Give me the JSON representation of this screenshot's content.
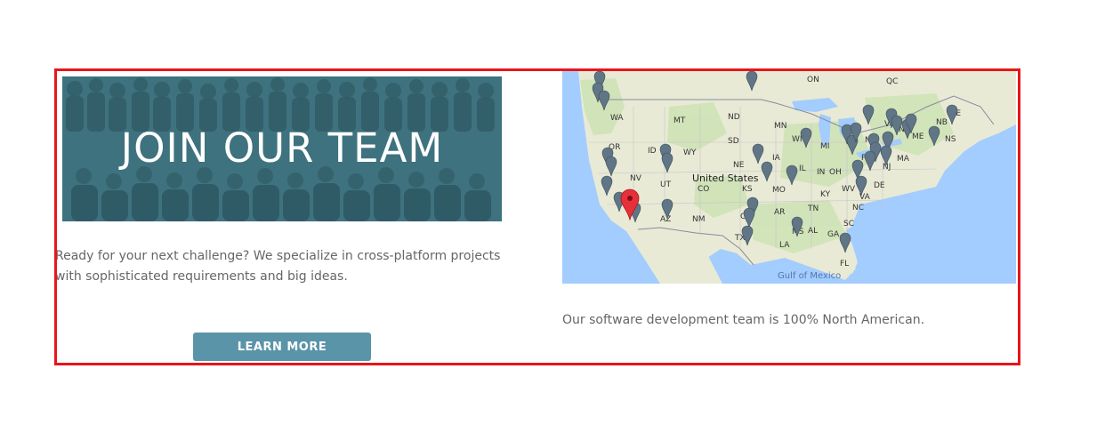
{
  "colors": {
    "frame_border": "#e8151b",
    "button_bg": "#5a94a9",
    "banner_overlay": "#3b6f7c",
    "body_text": "#666666",
    "map_water": "#a3ccff",
    "map_land": "#e8ead5",
    "marker_gray": "#607585",
    "marker_red": "#e8303a"
  },
  "recruiting": {
    "banner_title": "JOIN OUR TEAM",
    "intro_text": "Ready for your next challenge? We specialize in cross-platform projects with sophisticated requirements and big ideas.",
    "button_label": "LEARN MORE"
  },
  "map": {
    "country_label": "United States",
    "water_label": "Gulf of Mexico",
    "region_labels": [
      "ON",
      "QC",
      "NB",
      "PE",
      "NS",
      "WA",
      "MT",
      "ND",
      "MN",
      "OR",
      "ID",
      "WY",
      "SD",
      "WI",
      "MI",
      "NY",
      "VT",
      "NH",
      "ME",
      "MA",
      "NV",
      "UT",
      "CO",
      "NE",
      "IA",
      "IL",
      "IN",
      "OH",
      "PA",
      "NJ",
      "DE",
      "KS",
      "MO",
      "KY",
      "WV",
      "VA",
      "CA",
      "AZ",
      "NM",
      "OK",
      "AR",
      "TN",
      "NC",
      "SC",
      "TX",
      "LA",
      "MS",
      "AL",
      "GA",
      "FL"
    ],
    "marker_icon": "map-pin-icon",
    "highlight_marker_icon": "map-pin-highlight-icon",
    "caption": "Our software development team is 100% North American."
  }
}
